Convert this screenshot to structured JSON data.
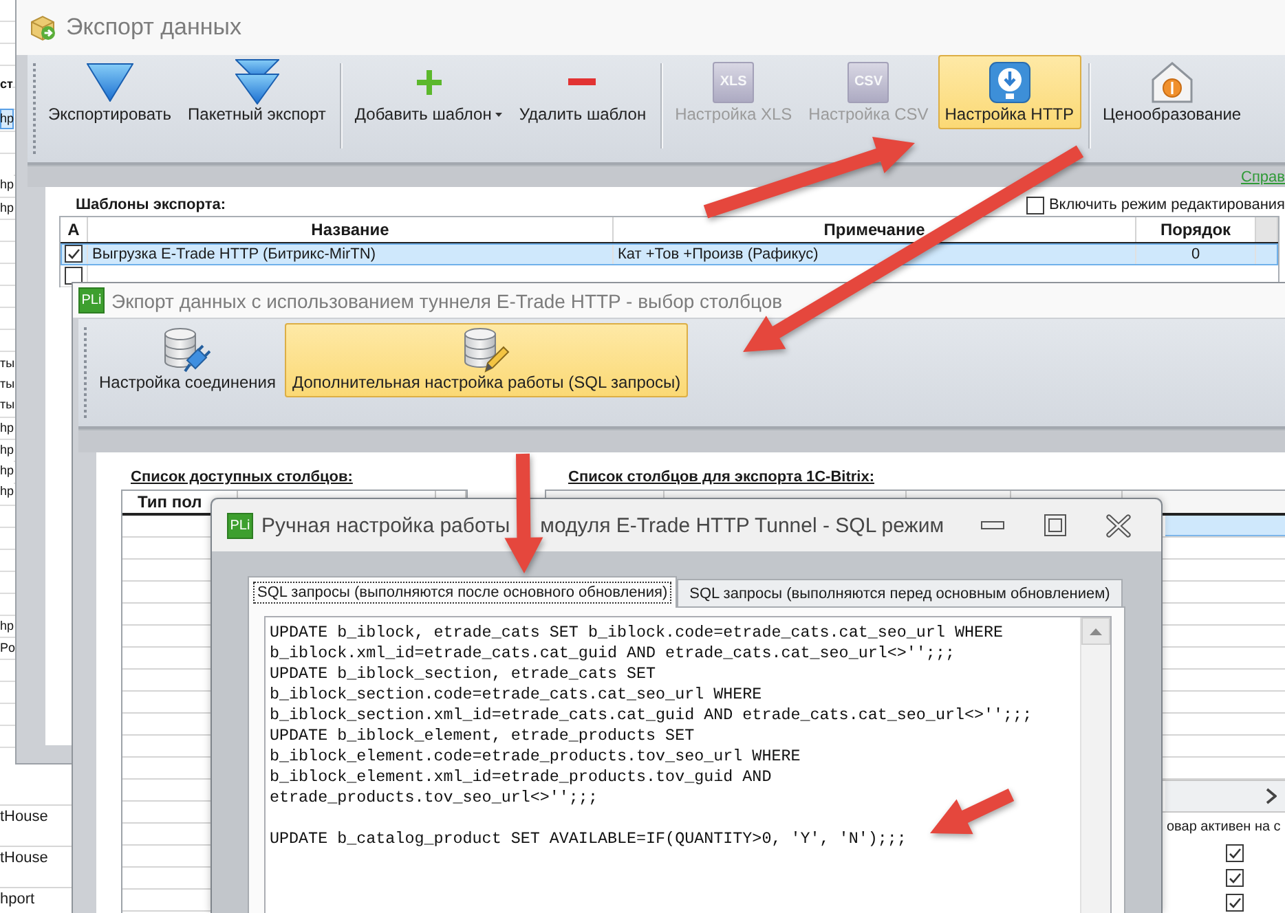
{
  "background_window": {
    "header_cell": "ст",
    "side_cells": [
      {
        "text": "hp",
        "selected": true
      },
      {
        "text": "hp",
        "selected": false
      },
      {
        "text": "hp",
        "selected": false
      },
      {
        "text": "ты",
        "selected": false
      },
      {
        "text": "ты",
        "selected": false
      },
      {
        "text": "ты",
        "selected": false
      },
      {
        "text": "hp",
        "selected": false
      },
      {
        "text": "hp",
        "selected": false
      },
      {
        "text": "hp",
        "selected": false
      },
      {
        "text": "hp",
        "selected": false
      },
      {
        "text": "hp",
        "selected": false
      },
      {
        "text": "Po",
        "selected": false
      }
    ],
    "lower_cells": [
      "tHouse",
      "tHouse",
      "hport"
    ]
  },
  "export_window": {
    "title": "Экспорт данных",
    "toolbar_groups": [
      [
        {
          "label": "Экспортировать",
          "kind": "export",
          "disabled": false,
          "selected": false,
          "dropdown": false
        },
        {
          "label": "Пакетный экспорт",
          "kind": "batch",
          "disabled": false,
          "selected": false,
          "dropdown": false
        }
      ],
      [
        {
          "label": "Добавить шаблон",
          "kind": "add",
          "disabled": false,
          "selected": false,
          "dropdown": true
        },
        {
          "label": "Удалить шаблон",
          "kind": "delete",
          "disabled": false,
          "selected": false,
          "dropdown": false
        }
      ],
      [
        {
          "label": "Настройка XLS",
          "kind": "xls",
          "icon_text": "XLS",
          "disabled": true,
          "selected": false,
          "dropdown": false
        },
        {
          "label": "Настройка CSV",
          "kind": "csv",
          "icon_text": "CSV",
          "disabled": true,
          "selected": false,
          "dropdown": false
        },
        {
          "label": "Настройка HTTP",
          "kind": "http",
          "disabled": false,
          "selected": true,
          "dropdown": false
        }
      ],
      [
        {
          "label": "Ценообразование",
          "kind": "pricing",
          "disabled": false,
          "selected": false,
          "dropdown": false
        }
      ]
    ],
    "help_link": "Справ",
    "section_label": "Шаблоны экспорта:",
    "edit_mode": {
      "label": "Включить режим редактирования",
      "checked": false
    },
    "table": {
      "columns": [
        "А",
        "Название",
        "Примечание",
        "Порядок"
      ],
      "rows": [
        {
          "checked": true,
          "selected": true,
          "cells": [
            "Выгрузка E-Trade HTTP (Битрикс-MirTN)",
            "Кат +Тов +Произв (Рафикус)",
            "0"
          ]
        },
        {
          "checked": false,
          "selected": false
        }
      ]
    }
  },
  "columns_window": {
    "logo": "PLi",
    "title": "Экпорт данных с использованием туннеля E-Trade HTTP - выбор столбцов",
    "toolbar": [
      {
        "label": "Настройка соединения",
        "kind": "connection",
        "selected": false
      },
      {
        "label": "Дополнительная настройка работы (SQL запросы)",
        "kind": "sql",
        "selected": true
      }
    ],
    "available_list": {
      "label": "Список доступных столбцов:",
      "columns": [
        "Тип пол"
      ]
    },
    "export_list": {
      "label": "Список столбцов для экспорта 1С-Bitrix:",
      "rows": [
        {
          "selected": true
        },
        {
          "selected": false
        },
        {
          "selected": false
        },
        {
          "selected": false
        },
        {
          "selected": false
        },
        {
          "selected": false
        },
        {
          "selected": false
        },
        {
          "selected": false
        },
        {
          "selected": false
        },
        {
          "selected": false
        },
        {
          "selected": false
        },
        {
          "selected": false
        }
      ]
    },
    "active_flag": {
      "column": "овар активен на с",
      "rows": [
        {
          "checked": true
        },
        {
          "checked": true
        },
        {
          "checked": true
        }
      ]
    }
  },
  "sql_window": {
    "logo": "PLi",
    "title_parts": [
      "Ручная настройка работы",
      "модуля E-Trade HTTP Tunnel - SQL режим"
    ],
    "tabs": [
      {
        "label": "SQL запросы (выполняются после основного обновления)",
        "selected": true
      },
      {
        "label": "SQL запросы (выполняются перед основным обновлением)",
        "selected": false
      }
    ],
    "sql_blocks": [
      [
        "UPDATE b_iblock, etrade_cats SET b_iblock.code=etrade_cats.cat_seo_url WHERE",
        "b_iblock.xml_id=etrade_cats.cat_guid AND etrade_cats.cat_seo_url<>'';;;",
        "UPDATE b_iblock_section, etrade_cats SET",
        "b_iblock_section.code=etrade_cats.cat_seo_url WHERE",
        "b_iblock_section.xml_id=etrade_cats.cat_guid AND etrade_cats.cat_seo_url<>'';;;",
        "UPDATE b_iblock_element, etrade_products SET",
        "b_iblock_element.code=etrade_products.tov_seo_url WHERE",
        "b_iblock_element.xml_id=etrade_products.tov_guid AND",
        "etrade_products.tov_seo_url<>'';;;"
      ],
      [
        "UPDATE b_catalog_product SET AVAILABLE=IF(QUANTITY>0, 'Y', 'N');;;"
      ]
    ]
  }
}
